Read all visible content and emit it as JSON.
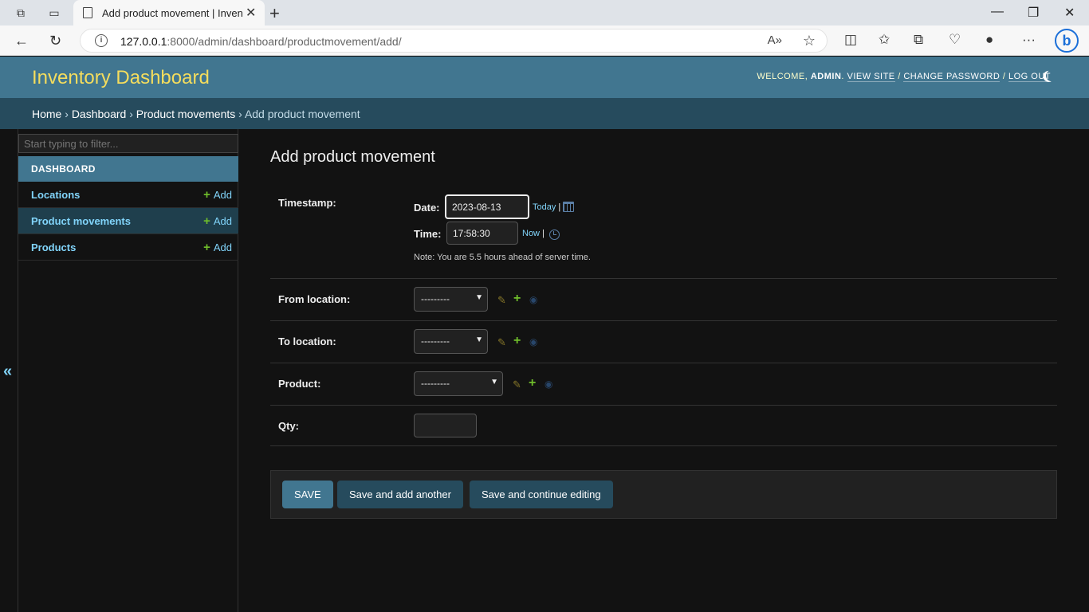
{
  "browser": {
    "tab_title": "Add product movement | Inventory",
    "url_host": "127.0.0.1",
    "url_rest": ":8000/admin/dashboard/productmovement/add/"
  },
  "header": {
    "brand": "Inventory Dashboard",
    "welcome": "WELCOME,",
    "user": "ADMIN",
    "view_site": "VIEW SITE",
    "change_password": "CHANGE PASSWORD",
    "log_out": "LOG OUT"
  },
  "breadcrumbs": [
    "Home",
    "Dashboard",
    "Product movements",
    "Add product movement"
  ],
  "sidebar": {
    "filter_placeholder": "Start typing to filter...",
    "app_caption": "DASHBOARD",
    "add_label": "Add",
    "models": [
      {
        "name": "Locations"
      },
      {
        "name": "Product movements"
      },
      {
        "name": "Products"
      }
    ],
    "toggle": "«"
  },
  "form": {
    "title": "Add product movement",
    "timestamp_label": "Timestamp:",
    "date_label": "Date:",
    "date_value": "2023-08-13",
    "today_link": "Today",
    "time_label": "Time:",
    "time_value": "17:58:30",
    "now_link": "Now",
    "tz_note": "Note: You are 5.5 hours ahead of server time.",
    "from_location_label": "From location:",
    "to_location_label": "To location:",
    "product_label": "Product:",
    "qty_label": "Qty:",
    "empty_choice": "---------"
  },
  "buttons": {
    "save": "SAVE",
    "save_add_another": "Save and add another",
    "save_continue": "Save and continue editing"
  },
  "colors": {
    "header_bg": "#417690",
    "breadcrumb_bg": "#264b5d",
    "brand": "#f5dd5d",
    "link": "#81d4fa",
    "add_green": "#70bf2b",
    "body_bg": "#121212"
  }
}
